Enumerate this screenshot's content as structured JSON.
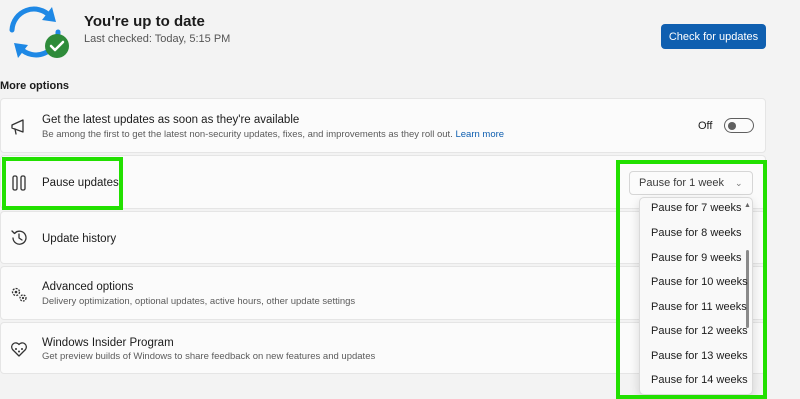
{
  "status": {
    "title": "You're up to date",
    "last_checked": "Last checked: Today, 5:15 PM",
    "check_button": "Check for updates"
  },
  "more_options": {
    "heading": "More options",
    "latest_updates": {
      "title": "Get the latest updates as soon as they're available",
      "desc": "Be among the first to get the latest non-security updates, fixes, and improvements as they roll out.",
      "learn_more": "Learn more",
      "toggle_label": "Off",
      "toggle_on": false
    },
    "pause_updates": {
      "title": "Pause updates",
      "selected": "Pause for 1 week",
      "options": [
        "Pause for 7 weeks",
        "Pause for 8 weeks",
        "Pause for 9 weeks",
        "Pause for 10 weeks",
        "Pause for 11 weeks",
        "Pause for 12 weeks",
        "Pause for 13 weeks",
        "Pause for 14 weeks"
      ]
    },
    "update_history": {
      "title": "Update history"
    },
    "advanced_options": {
      "title": "Advanced options",
      "desc": "Delivery optimization, optional updates, active hours, other update settings"
    },
    "insider_program": {
      "title": "Windows Insider Program",
      "desc": "Get preview builds of Windows to share feedback on new features and updates"
    }
  },
  "colors": {
    "accent": "#0f5fb0",
    "highlight": "#22e000",
    "sync_icon": "#1e88e5",
    "check_badge": "#2e8b3a"
  },
  "icons": {
    "status": "sync-check-icon",
    "latest_updates": "megaphone-icon",
    "pause_updates": "pause-icon",
    "update_history": "history-icon",
    "advanced_options": "gears-icon",
    "insider_program": "insider-heart-icon"
  }
}
